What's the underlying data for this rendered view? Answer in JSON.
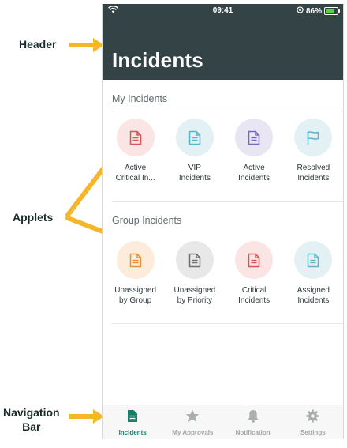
{
  "callouts": {
    "header": "Header",
    "applets": "Applets",
    "navigation": "Navigation\nBar"
  },
  "status_bar": {
    "time": "09:41",
    "battery": "86%"
  },
  "header": {
    "title": "Incidents"
  },
  "sections": [
    {
      "title": "My Incidents",
      "applets": [
        {
          "label": "Active\nCritical In...",
          "icon": "document-icon",
          "color": "#d9534f",
          "bg": "#fbe4e4"
        },
        {
          "label": "VIP\nIncidents",
          "icon": "document-icon",
          "color": "#5bb5c8",
          "bg": "#e3f1f5"
        },
        {
          "label": "Active\nIncidents",
          "icon": "document-icon",
          "color": "#7a68b5",
          "bg": "#e9e6f3"
        },
        {
          "label": "Resolved\nIncidents",
          "icon": "flag-icon",
          "color": "#5bb5c8",
          "bg": "#e3f1f5"
        }
      ]
    },
    {
      "title": "Group Incidents",
      "applets": [
        {
          "label": "Unassigned\nby Group",
          "icon": "document-icon",
          "color": "#e8913a",
          "bg": "#fdebdc"
        },
        {
          "label": "Unassigned\nby Priority",
          "icon": "document-icon",
          "color": "#6e6e6e",
          "bg": "#e8e8e8"
        },
        {
          "label": "Critical\nIncidents",
          "icon": "document-icon",
          "color": "#d9534f",
          "bg": "#fbe4e4"
        },
        {
          "label": "Assigned\nIncidents",
          "icon": "document-icon",
          "color": "#5bb5c8",
          "bg": "#e3f1f5"
        }
      ]
    }
  ],
  "nav": [
    {
      "label": "Incidents",
      "icon": "document-icon",
      "active": true
    },
    {
      "label": "My Approvals",
      "icon": "star-icon",
      "active": false
    },
    {
      "label": "Notification",
      "icon": "bell-icon",
      "active": false
    },
    {
      "label": "Settings",
      "icon": "gear-icon",
      "active": false
    }
  ],
  "colors": {
    "header_bg": "#334346",
    "accent": "#1b7c6c",
    "callout_arrow": "#f5b62a"
  }
}
